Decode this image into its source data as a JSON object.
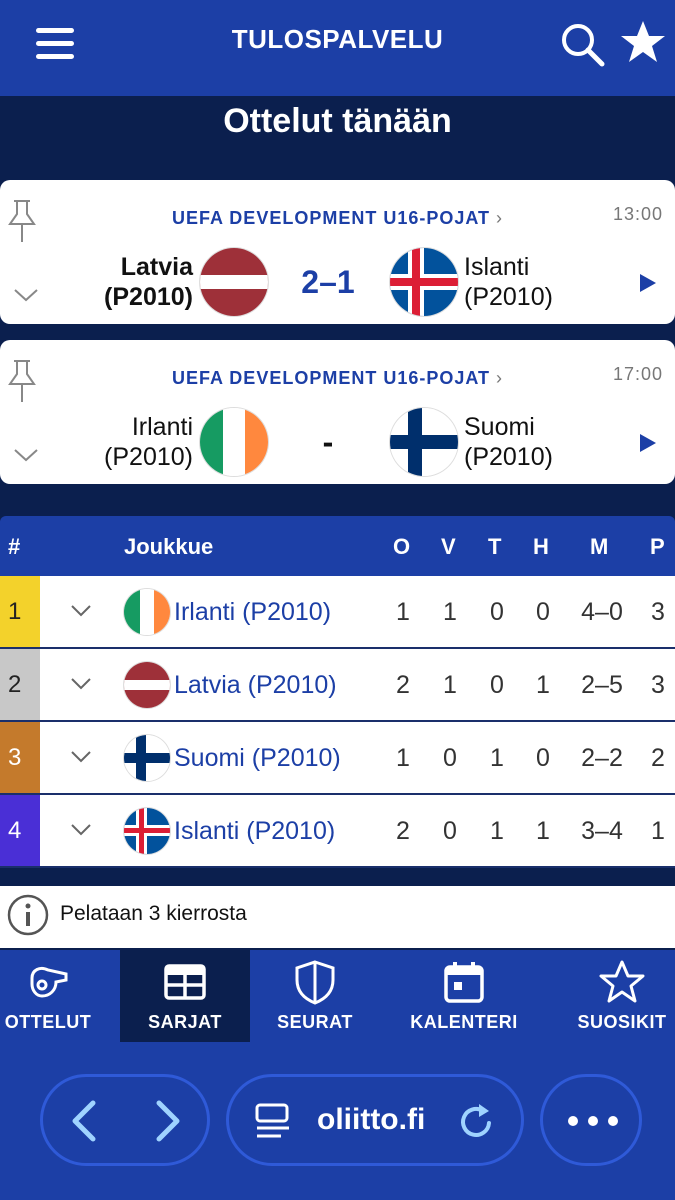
{
  "header": {
    "title": "TULOSPALVELU"
  },
  "page_title": "Ottelut tänään",
  "matches": [
    {
      "competition": "UEFA DEVELOPMENT U16-POJAT",
      "time": "13:00",
      "home": {
        "line1": "Latvia",
        "line2": "(P2010)",
        "flag": "latvia-flag"
      },
      "away": {
        "line1": "Islanti",
        "line2": "(P2010)",
        "flag": "iceland-flag"
      },
      "score": "2–1"
    },
    {
      "competition": "UEFA DEVELOPMENT U16-POJAT",
      "time": "17:00",
      "home": {
        "line1": "Irlanti",
        "line2": "(P2010)",
        "flag": "ireland-flag"
      },
      "away": {
        "line1": "Suomi",
        "line2": "(P2010)",
        "flag": "finland-flag"
      },
      "score": "-"
    }
  ],
  "standings": {
    "headers": {
      "rank": "#",
      "team": "Joukkue",
      "o": "O",
      "v": "V",
      "t": "T",
      "h": "H",
      "m": "M",
      "p": "P"
    },
    "rows": [
      {
        "rank": "1",
        "team": "Irlanti (P2010)",
        "o": "1",
        "v": "1",
        "t": "0",
        "h": "0",
        "m": "4–0",
        "p": "3",
        "rank_color": "#f3d22b"
      },
      {
        "rank": "2",
        "team": "Latvia (P2010)",
        "o": "2",
        "v": "1",
        "t": "0",
        "h": "1",
        "m": "2–5",
        "p": "3",
        "rank_color": "#c8c8c8"
      },
      {
        "rank": "3",
        "team": "Suomi (P2010)",
        "o": "1",
        "v": "0",
        "t": "1",
        "h": "0",
        "m": "2–2",
        "p": "2",
        "rank_color": "#c47a2c"
      },
      {
        "rank": "4",
        "team": "Islanti (P2010)",
        "o": "2",
        "v": "0",
        "t": "1",
        "h": "1",
        "m": "3–4",
        "p": "1",
        "rank_color": "#4a2fd6"
      }
    ]
  },
  "info": {
    "text": "Pelataan 3 kierrosta"
  },
  "tabs": [
    {
      "label": "OTTELUT",
      "icon": "whistle-icon"
    },
    {
      "label": "SARJAT",
      "icon": "table-icon",
      "active": true
    },
    {
      "label": "SEURAT",
      "icon": "shield-icon"
    },
    {
      "label": "KALENTERI",
      "icon": "calendar-icon"
    },
    {
      "label": "SUOSIKIT",
      "icon": "star-outline-icon"
    }
  ],
  "browser": {
    "url": "oliitto.fi"
  },
  "colors": {
    "primary": "#1c3fa6",
    "dark": "#0b1f4e"
  }
}
